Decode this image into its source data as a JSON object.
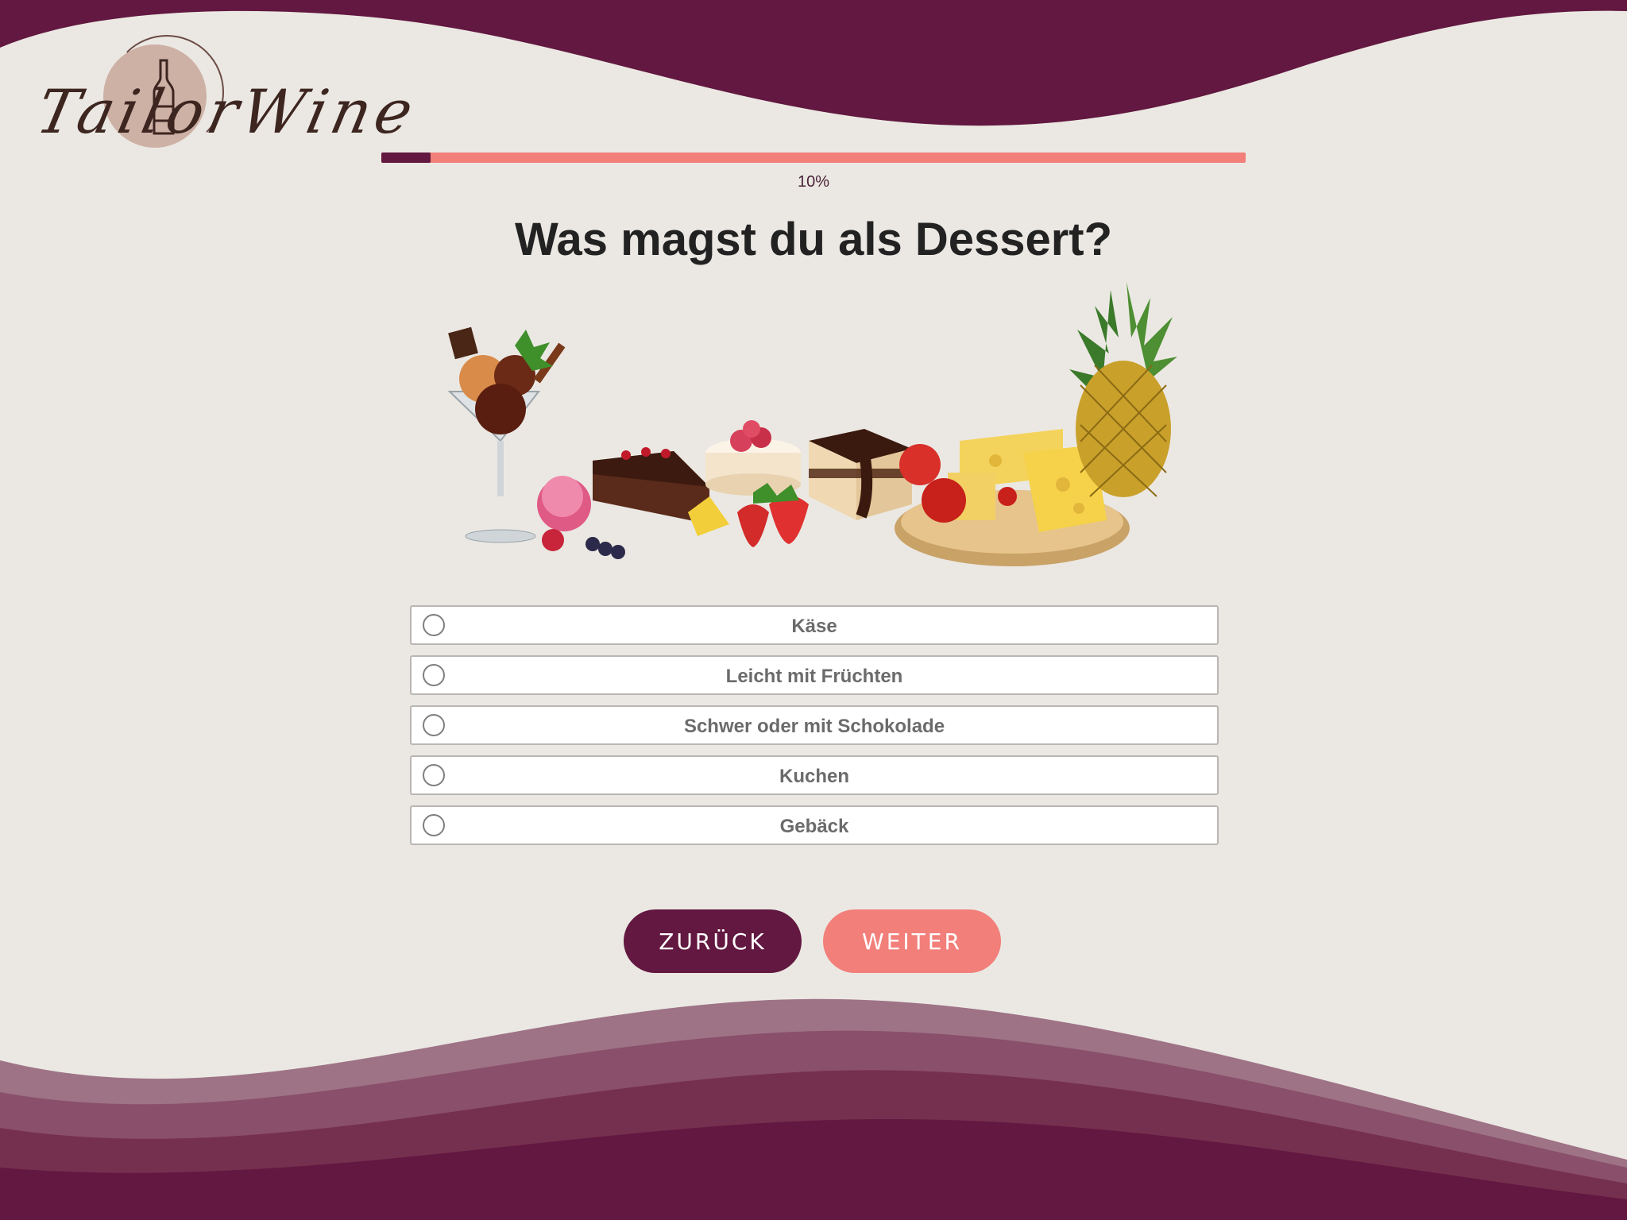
{
  "brand": {
    "logo_text": "TailorWine"
  },
  "progress": {
    "value": 0.1,
    "label": "10%"
  },
  "question": {
    "title": "Was magst du als Dessert?"
  },
  "illustration": {
    "icon": "dessert-collage-image"
  },
  "options": [
    {
      "label": "Käse",
      "selected": false
    },
    {
      "label": "Leicht mit Früchten",
      "selected": false
    },
    {
      "label": "Schwer oder mit Schokolade",
      "selected": false
    },
    {
      "label": "Kuchen",
      "selected": false
    },
    {
      "label": "Gebäck",
      "selected": false
    }
  ],
  "nav": {
    "back_label": "ZURÜCK",
    "next_label": "WEITER"
  },
  "colors": {
    "primary": "#621840",
    "accent": "#f27f7a",
    "background": "#ebe8e3"
  }
}
